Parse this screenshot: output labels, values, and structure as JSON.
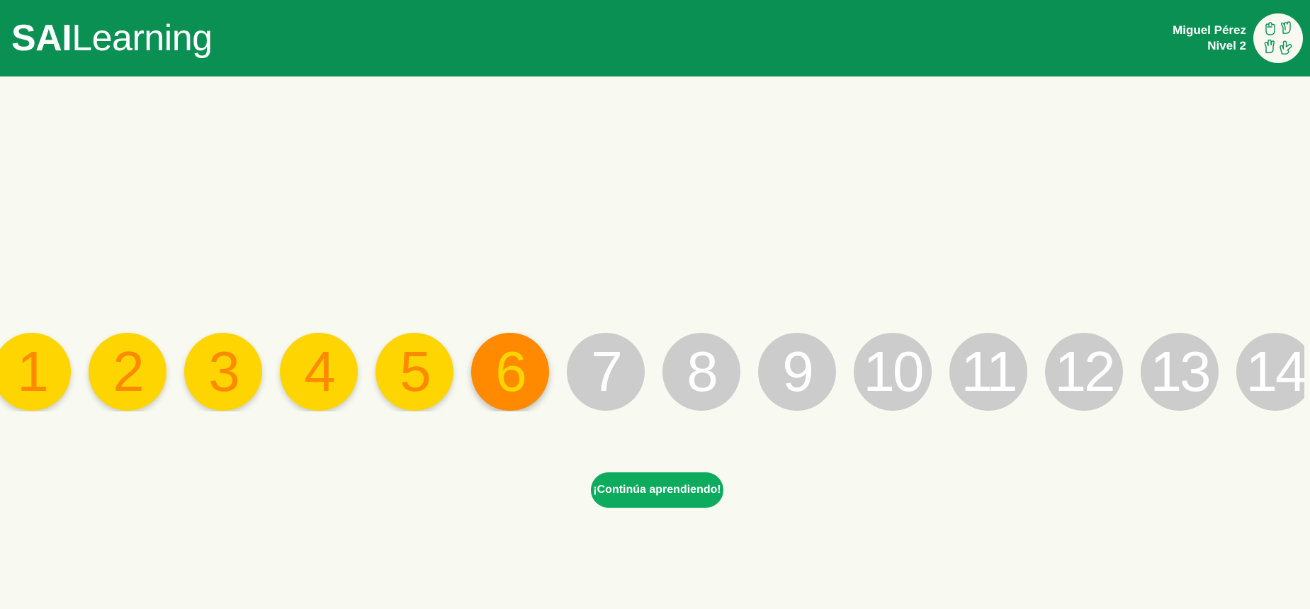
{
  "header": {
    "brand_bold": "SAI",
    "brand_light": "Learning"
  },
  "user": {
    "name": "Miguel Pérez",
    "level": "Nivel 2",
    "avatar_icon": "sign-language-hands-icon"
  },
  "levels": [
    {
      "label": "1",
      "status": "completed"
    },
    {
      "label": "2",
      "status": "completed"
    },
    {
      "label": "3",
      "status": "completed"
    },
    {
      "label": "4",
      "status": "completed"
    },
    {
      "label": "5",
      "status": "completed"
    },
    {
      "label": "6",
      "status": "current"
    },
    {
      "label": "7",
      "status": "locked"
    },
    {
      "label": "8",
      "status": "locked"
    },
    {
      "label": "9",
      "status": "locked"
    },
    {
      "label": "10",
      "status": "locked"
    },
    {
      "label": "11",
      "status": "locked"
    },
    {
      "label": "12",
      "status": "locked"
    },
    {
      "label": "13",
      "status": "locked"
    },
    {
      "label": "14",
      "status": "locked"
    }
  ],
  "continue_button": {
    "label": "¡Continúa aprendiendo!"
  },
  "colors": {
    "header_green": "#0a9053",
    "page_background": "#f8f9f1",
    "completed_fill": "#ffd500",
    "completed_text": "#ff8a00",
    "current_fill": "#ff8a00",
    "current_text": "#ffd500",
    "locked_fill": "#cccccc",
    "locked_text": "#ffffff",
    "button_green": "#0cab5e"
  }
}
